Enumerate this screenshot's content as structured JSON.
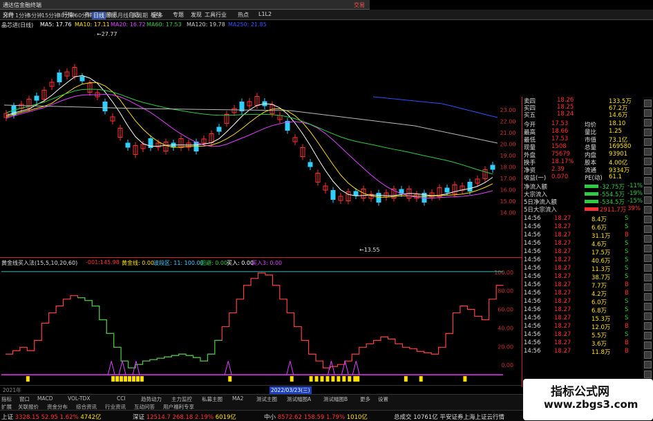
{
  "window": {
    "title": "通达信金融终端",
    "right_text": "交易"
  },
  "menu": [
    "文件",
    "行情",
    "市场",
    "资讯",
    "自选",
    "板块",
    "专题",
    "发现",
    "工具",
    "行业",
    "热点",
    "L1L2"
  ],
  "periods": {
    "items": [
      "分时",
      "1分钟",
      "5分钟",
      "15分钟",
      "30分钟",
      "60分钟",
      "日线",
      "周线",
      "月线",
      "多周期",
      "更多"
    ],
    "active": "日线"
  },
  "stock": {
    "name": "晶芯进(日线)"
  },
  "ma_legend": [
    {
      "label": "MA5: 17.76",
      "color": "#ffffff"
    },
    {
      "label": "MA10: 17.11",
      "color": "#ffe000"
    },
    {
      "label": "MA20: 16.72",
      "color": "#e040ff"
    },
    {
      "label": "MA60: 17.53",
      "color": "#2ecc40"
    },
    {
      "label": "MA120: 19.78",
      "color": "#cccccc"
    },
    {
      "label": "MA250: 21.85",
      "color": "#3050ff"
    }
  ],
  "annotations": {
    "high": "27.77",
    "low": "13.55"
  },
  "price_axis": [
    "23.00",
    "22.00",
    "21.00",
    "20.00",
    "19.00",
    "18.00",
    "17.00",
    "16.00",
    "15.00",
    "14.00"
  ],
  "indicator": {
    "name": "黄金线买入法(15,5,10,20,60)",
    "values": [
      {
        "label": "-001:145.98",
        "color": "#ff3030"
      },
      {
        "label": "黄金线: 0.00",
        "color": "#ffe000"
      },
      {
        "label": "波段区: 11: 100.00",
        "color": "#3ad0ff"
      },
      {
        "label": "回避: 0.00",
        "color": "#2ecc40"
      },
      {
        "label": "买入: 0.00",
        "color": "#ffffff"
      },
      {
        "label": "买入3: 0.00",
        "color": "#e040ff"
      }
    ],
    "axis": [
      "100.00",
      "80.00",
      "60.00",
      "40.00",
      "20.00",
      "0.00"
    ]
  },
  "dates": {
    "left": "2021年",
    "highlight": "2022/03/23(三)"
  },
  "quote": {
    "rows": [
      {
        "k": "卖四",
        "v": "18.26",
        "v2": "133.5万"
      },
      {
        "k": "买四",
        "v": "18.25",
        "v2": "67.2万"
      },
      {
        "k": "买五",
        "v": "18.24",
        "v2": "14.6万"
      }
    ],
    "stats": [
      {
        "k": "今开",
        "v": "17.53",
        "k2": "均价",
        "v2": "18.10"
      },
      {
        "k": "最高",
        "v": "18.66",
        "k2": "量比",
        "v2": "1.25"
      },
      {
        "k": "最低",
        "v": "17.53",
        "k2": "市值",
        "v2": "73.1亿"
      },
      {
        "k": "现量",
        "v": "1508",
        "k2": "总量",
        "v2": "169580"
      },
      {
        "k": "外盘",
        "v": "75679",
        "k2": "内盘",
        "v2": "93901"
      },
      {
        "k": "换手",
        "v": "18.17%",
        "k2": "股本",
        "v2": "4.00亿"
      },
      {
        "k": "净资",
        "v": "2.39",
        "k2": "流通",
        "v2": "9334万"
      },
      {
        "k": "收益(一)",
        "v": "0.070",
        "k2": "PE(动)",
        "v2": "61.1"
      }
    ],
    "flows": [
      {
        "k": "净流入额",
        "v": "-32.75万",
        "pct": "-11%",
        "c": "#2ecc40"
      },
      {
        "k": "大宗流入",
        "v": "-554.5万",
        "pct": "-19%",
        "c": "#2ecc40"
      },
      {
        "k": "5日净流入额",
        "v": "-534.5万",
        "pct": "-15%",
        "c": "#2ecc40"
      },
      {
        "k": "5日大宗流入",
        "v": "2911.7万",
        "pct": "39%",
        "c": "#ff3030"
      }
    ]
  },
  "ticks": [
    {
      "t": "14:56",
      "p": "18.27",
      "v": "8.4万",
      "s": "S"
    },
    {
      "t": "14:56",
      "p": "18.27",
      "v": "6.6万",
      "s": "S"
    },
    {
      "t": "14:56",
      "p": "18.27",
      "v": "31.1万",
      "s": "B"
    },
    {
      "t": "14:56",
      "p": "18.27",
      "v": "4.6万",
      "s": "S"
    },
    {
      "t": "14:56",
      "p": "18.27",
      "v": "17.5万",
      "s": "S"
    },
    {
      "t": "14:56",
      "p": "18.27",
      "v": "40.6万",
      "s": "S"
    },
    {
      "t": "14:56",
      "p": "18.27",
      "v": "11.3万",
      "s": "S"
    },
    {
      "t": "14:56",
      "p": "18.27",
      "v": "38.7万",
      "s": "S"
    },
    {
      "t": "14:56",
      "p": "18.27",
      "v": "7.7万",
      "s": "B"
    },
    {
      "t": "14:56",
      "p": "18.27",
      "v": "4.2万",
      "s": "B"
    },
    {
      "t": "14:56",
      "p": "18.27",
      "v": "6.0万",
      "s": "S"
    },
    {
      "t": "14:56",
      "p": "18.27",
      "v": "6.8万",
      "s": "S"
    },
    {
      "t": "14:56",
      "p": "18.27",
      "v": "15.3万",
      "s": "S"
    },
    {
      "t": "14:56",
      "p": "18.27",
      "v": "12.0万",
      "s": "B"
    },
    {
      "t": "14:56",
      "p": "18.27",
      "v": "5.5万",
      "s": "S"
    },
    {
      "t": "14:56",
      "p": "18.27",
      "v": "3.6万",
      "s": "B"
    },
    {
      "t": "14:56",
      "p": "18.27",
      "v": "11.8万",
      "s": "B"
    }
  ],
  "bottom_tabs": [
    "指标",
    "窗口",
    "MACD",
    "VOL-TDX",
    "CCI",
    "趋势动力",
    "主力监控",
    "私募主图",
    "MA2",
    "测试主图",
    "测试幅图A",
    "测试幅图B",
    "更多",
    "设置"
  ],
  "bottom_tabs2": [
    "扩展",
    "关联报价",
    "资金分布",
    "综合资讯",
    "行业资讯",
    "互动问答",
    "用户福利专享"
  ],
  "status": [
    {
      "label": "上证",
      "val": "3328.15",
      "chg": "52.95",
      "pct": "1.62%",
      "amt": "4742亿",
      "c": "#ff3030"
    },
    {
      "label": "深证",
      "val": "12514.7",
      "chg": "268.18",
      "pct": "2.19%",
      "amt": "6019亿",
      "c": "#ff3030"
    },
    {
      "label": "中小",
      "val": "8572.62",
      "chg": "158.59",
      "pct": "1.79%",
      "amt": "1010亿",
      "c": "#ff3030"
    }
  ],
  "status_tail": "总成交 10761亿 平安证券上海上证云行情",
  "watermark": {
    "line1": "指标公式网",
    "line2": "www.zbgs3.com"
  }
}
